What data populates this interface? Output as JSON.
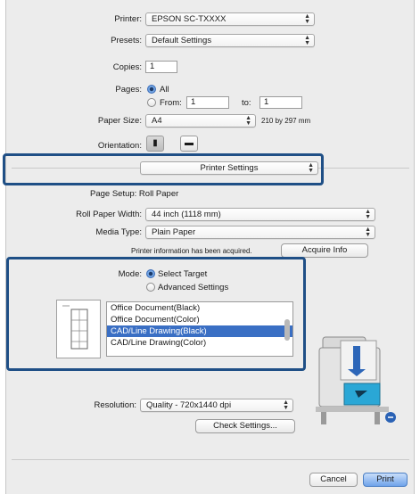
{
  "printer": {
    "label": "Printer:",
    "value": "EPSON SC-TXXXX"
  },
  "presets": {
    "label": "Presets:",
    "value": "Default Settings"
  },
  "copies": {
    "label": "Copies:",
    "value": "1"
  },
  "pages": {
    "label": "Pages:",
    "all_label": "All",
    "from_label": "From:",
    "from_value": "1",
    "to_label": "to:",
    "to_value": "1"
  },
  "paper_size": {
    "label": "Paper Size:",
    "value": "A4",
    "dimensions": "210 by 297 mm"
  },
  "orientation": {
    "label": "Orientation:",
    "portrait_icon": "portrait-icon",
    "landscape_icon": "landscape-icon"
  },
  "section_popup": {
    "value": "Printer Settings"
  },
  "page_setup": {
    "text": "Page Setup: Roll Paper"
  },
  "roll_paper_width": {
    "label": "Roll Paper Width:",
    "value": "44 inch (1118 mm)"
  },
  "media_type": {
    "label": "Media Type:",
    "value": "Plain Paper"
  },
  "printer_info": {
    "text": "Printer information has been acquired.",
    "button": "Acquire Info"
  },
  "mode": {
    "label": "Mode:",
    "select_target": "Select Target",
    "advanced": "Advanced Settings"
  },
  "target_list": {
    "items": [
      "Office Document(Black)",
      "Office Document(Color)",
      "CAD/Line Drawing(Black)",
      "CAD/Line Drawing(Color)"
    ],
    "selected_index": 2
  },
  "resolution": {
    "label": "Resolution:",
    "value": "Quality - 720x1440 dpi"
  },
  "check_settings": {
    "label": "Check Settings..."
  },
  "footer": {
    "cancel": "Cancel",
    "print": "Print"
  },
  "colors": {
    "highlight_border": "#1f4f86",
    "selection": "#3a6fc4",
    "default_button": "#6fa3ea"
  }
}
